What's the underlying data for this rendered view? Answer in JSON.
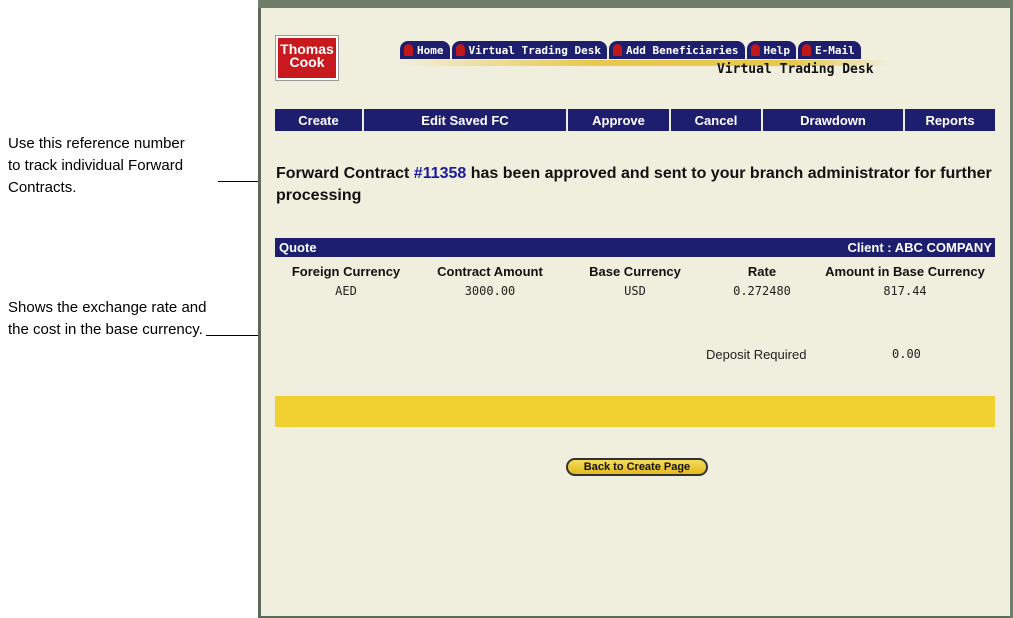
{
  "annotations": {
    "ref_note": "Use this reference number to track individual Forward Contracts.",
    "rate_note": "Shows the exchange rate and the cost in the base currency."
  },
  "logo": {
    "line1": "Thomas",
    "line2": "Cook"
  },
  "nav": {
    "tabs": [
      "Home",
      "Virtual Trading Desk",
      "Add Beneficiaries",
      "Help",
      "E-Mail"
    ],
    "page_title": "Virtual Trading Desk"
  },
  "menu": [
    "Create",
    "Edit Saved FC",
    "Approve",
    "Cancel",
    "Drawdown",
    "Reports"
  ],
  "message": {
    "prefix": "Forward Contract ",
    "ref": "#11358",
    "suffix": " has been approved and sent to your branch administrator for further processing"
  },
  "quote": {
    "label": "Quote",
    "client": "Client : ABC COMPANY",
    "headers": [
      "Foreign Currency",
      "Contract Amount",
      "Base Currency",
      "Rate",
      "Amount in Base Currency"
    ],
    "values": [
      "AED",
      "3000.00",
      "USD",
      "0.272480",
      "817.44"
    ]
  },
  "deposit": {
    "label": "Deposit Required",
    "value": "0.00"
  },
  "back_button": "Back to Create Page",
  "colors": {
    "navy": "#1e1e6e",
    "yellow": "#f0d030",
    "logo_red": "#c8191e",
    "page_bg": "#f0eedc"
  }
}
